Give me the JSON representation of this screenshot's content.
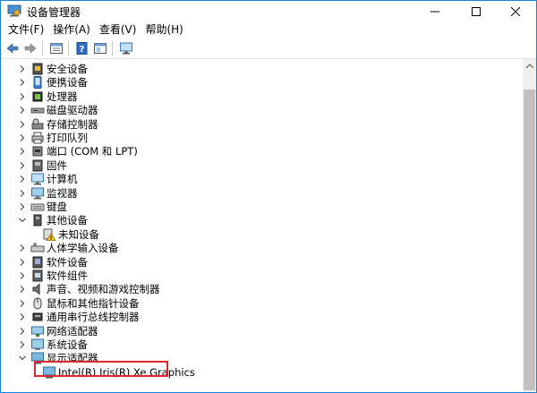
{
  "window": {
    "title": "设备管理器"
  },
  "menu": [
    {
      "label": "文件(F)"
    },
    {
      "label": "操作(A)"
    },
    {
      "label": "查看(V)"
    },
    {
      "label": "帮助(H)"
    }
  ],
  "toolbar": {
    "icons": [
      "back-icon",
      "forward-icon",
      "properties-icon",
      "help-icon",
      "view-icon",
      "monitor-icon"
    ]
  },
  "tree": {
    "items": [
      {
        "label": "安全设备",
        "icon": "security-device-icon",
        "expanded": false
      },
      {
        "label": "便携设备",
        "icon": "portable-device-icon",
        "expanded": false
      },
      {
        "label": "处理器",
        "icon": "processor-icon",
        "expanded": false
      },
      {
        "label": "磁盘驱动器",
        "icon": "disk-drive-icon",
        "expanded": false
      },
      {
        "label": "存储控制器",
        "icon": "storage-controller-icon",
        "expanded": false
      },
      {
        "label": "打印队列",
        "icon": "printer-icon",
        "expanded": false
      },
      {
        "label": "端口 (COM 和 LPT)",
        "icon": "port-icon",
        "expanded": false
      },
      {
        "label": "固件",
        "icon": "firmware-icon",
        "expanded": false
      },
      {
        "label": "计算机",
        "icon": "computer-icon",
        "expanded": false
      },
      {
        "label": "监视器",
        "icon": "monitor-icon",
        "expanded": false
      },
      {
        "label": "键盘",
        "icon": "keyboard-icon",
        "expanded": false
      },
      {
        "label": "其他设备",
        "icon": "other-device-icon",
        "expanded": true
      },
      {
        "label": "未知设备",
        "icon": "unknown-device-warning-icon",
        "child": true
      },
      {
        "label": "人体学输入设备",
        "icon": "hid-icon",
        "expanded": false
      },
      {
        "label": "软件设备",
        "icon": "software-device-icon",
        "expanded": false
      },
      {
        "label": "软件组件",
        "icon": "software-component-icon",
        "expanded": false
      },
      {
        "label": "声音、视频和游戏控制器",
        "icon": "sound-icon",
        "expanded": false
      },
      {
        "label": "鼠标和其他指针设备",
        "icon": "mouse-icon",
        "expanded": false
      },
      {
        "label": "通用串行总线控制器",
        "icon": "usb-icon",
        "expanded": false
      },
      {
        "label": "网络适配器",
        "icon": "network-adapter-icon",
        "expanded": false
      },
      {
        "label": "系统设备",
        "icon": "system-device-icon",
        "expanded": false
      },
      {
        "label": "显示适配器",
        "icon": "display-adapter-icon",
        "expanded": true
      },
      {
        "label": "Intel(R) Iris(R) Xe Graphics",
        "icon": "display-adapter-icon",
        "child": true,
        "highlighted": true
      }
    ]
  },
  "colors": {
    "accent": "#1883d7",
    "highlight": "#e0262d"
  }
}
